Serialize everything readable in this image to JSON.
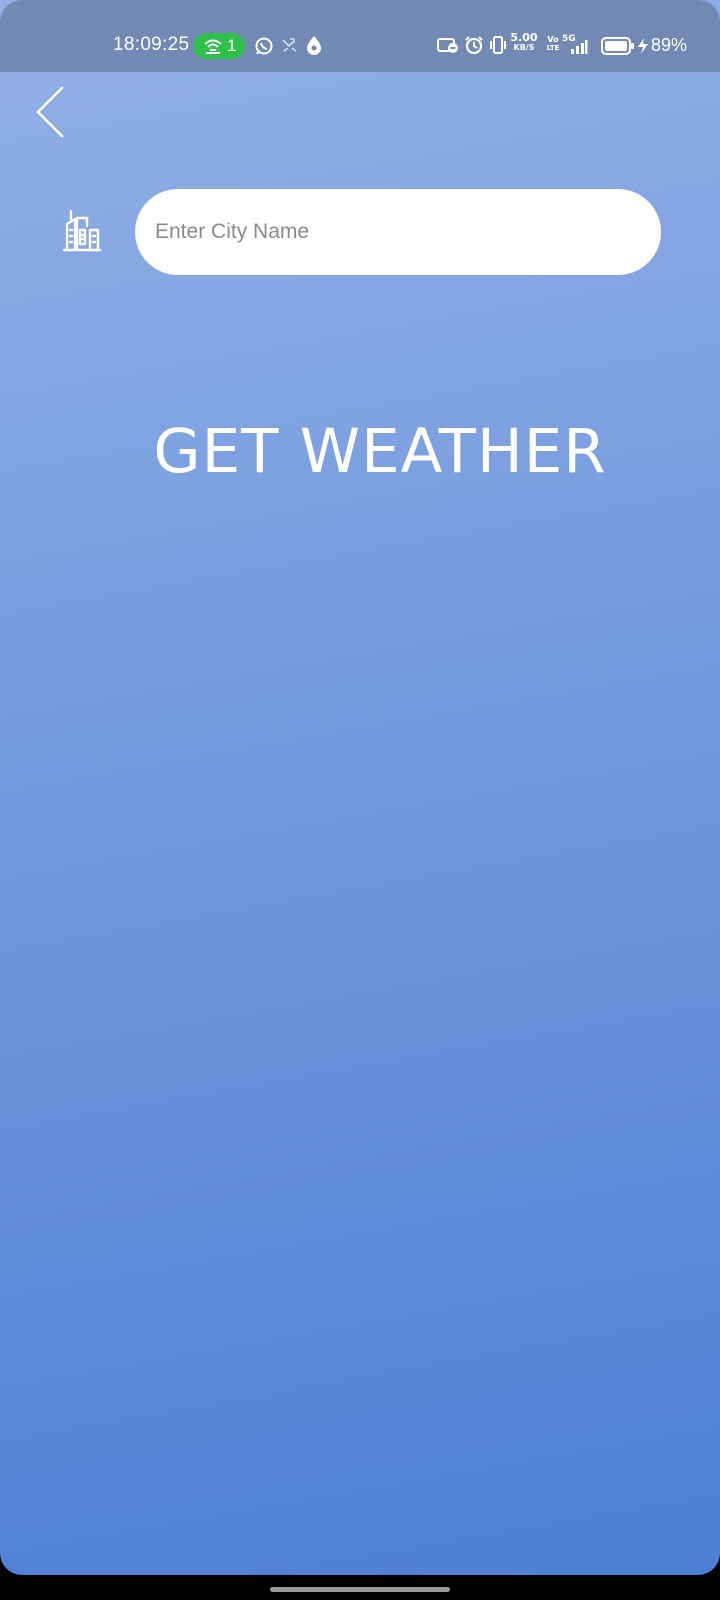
{
  "status_bar": {
    "time": "18:09:25",
    "hotspot_count": "1",
    "network_speed_value": "5.00",
    "network_speed_unit": "KB/S",
    "volte_top": "Vo",
    "volte_bottom": "LTE",
    "network_type": "5G",
    "battery_percent": "89%",
    "icons": [
      "hotspot-icon",
      "whatsapp-icon",
      "missed-call-icon",
      "notification-drop-icon",
      "screen-record-icon",
      "alarm-icon",
      "vibrate-icon",
      "signal-icon",
      "battery-icon",
      "charging-icon"
    ],
    "hotspot_color": "#2fbf4b"
  },
  "header": {
    "back_icon": "chevron-left-icon"
  },
  "search": {
    "city_icon": "city-buildings-icon",
    "placeholder": "Enter City Name",
    "value": ""
  },
  "action": {
    "get_weather_label": "GET WEATHER"
  },
  "theme": {
    "gradient_top": "#94b0e6",
    "gradient_bottom": "#4d7fd6",
    "status_bar_color": "#7189b3"
  }
}
